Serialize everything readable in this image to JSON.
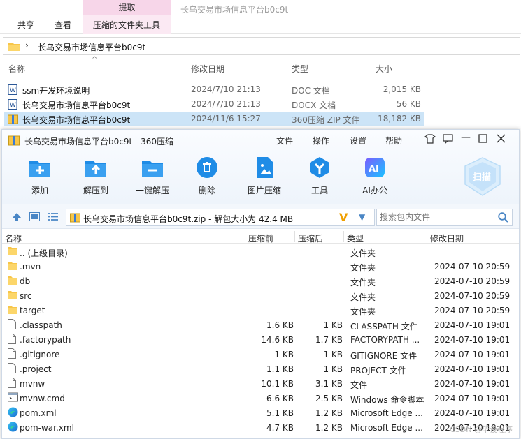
{
  "explorer": {
    "context_tab": "提取",
    "window_title": "长乌交易市场信息平台b0c9t",
    "ribbon_tabs": [
      "共享",
      "查看",
      "压缩的文件夹工具"
    ],
    "address_path": "长乌交易市场信息平台b0c9t",
    "columns": {
      "name": "名称",
      "date": "修改日期",
      "type": "类型",
      "size": "大小"
    },
    "files": [
      {
        "name": "ssm开发环境说明",
        "date": "2024/7/10 21:13",
        "type": "DOC 文档",
        "size": "2,015 KB",
        "icon": "word-doc-icon"
      },
      {
        "name": "长乌交易市场信息平台b0c9t",
        "date": "2024/7/10 21:13",
        "type": "DOCX 文档",
        "size": "56 KB",
        "icon": "word-doc-icon"
      },
      {
        "name": "长乌交易市场信息平台b0c9t",
        "date": "2024/11/6 15:27",
        "type": "360压缩 ZIP 文件",
        "size": "18,182 KB",
        "icon": "zip-archive-icon"
      }
    ]
  },
  "zip": {
    "title": "长乌交易市场信息平台b0c9t - 360压缩",
    "menu": [
      "文件",
      "操作",
      "设置",
      "帮助"
    ],
    "toolbar": [
      {
        "label": "添加",
        "icon": "add-icon"
      },
      {
        "label": "解压到",
        "icon": "extract-to-icon"
      },
      {
        "label": "一键解压",
        "icon": "one-click-extract-icon"
      },
      {
        "label": "删除",
        "icon": "delete-icon"
      },
      {
        "label": "图片压缩",
        "icon": "image-compress-icon"
      },
      {
        "label": "工具",
        "icon": "tools-icon"
      },
      {
        "label": "AI办公",
        "icon": "ai-office-icon"
      }
    ],
    "scan_label": "扫描",
    "path_text": "长乌交易市场信息平台b0c9t.zip - 解包大小为 42.4 MB",
    "search_placeholder": "搜索包内文件",
    "columns": {
      "name": "名称",
      "packed": "压缩前",
      "unpacked": "压缩后",
      "type": "类型",
      "date": "修改日期"
    },
    "rows": [
      {
        "name": ".. (上级目录)",
        "packed": "",
        "unpacked": "",
        "type": "文件夹",
        "date": "",
        "icon": "folder-icon"
      },
      {
        "name": ".mvn",
        "packed": "",
        "unpacked": "",
        "type": "文件夹",
        "date": "2024-07-10 20:59",
        "icon": "folder-icon"
      },
      {
        "name": "db",
        "packed": "",
        "unpacked": "",
        "type": "文件夹",
        "date": "2024-07-10 20:59",
        "icon": "folder-icon"
      },
      {
        "name": "src",
        "packed": "",
        "unpacked": "",
        "type": "文件夹",
        "date": "2024-07-10 20:59",
        "icon": "folder-icon"
      },
      {
        "name": "target",
        "packed": "",
        "unpacked": "",
        "type": "文件夹",
        "date": "2024-07-10 20:59",
        "icon": "folder-icon"
      },
      {
        "name": ".classpath",
        "packed": "1.6 KB",
        "unpacked": "1 KB",
        "type": "CLASSPATH 文件",
        "date": "2024-07-10 19:01",
        "icon": "file-icon"
      },
      {
        "name": ".factorypath",
        "packed": "14.6 KB",
        "unpacked": "1.7 KB",
        "type": "FACTORYPATH ...",
        "date": "2024-07-10 19:01",
        "icon": "file-icon"
      },
      {
        "name": ".gitignore",
        "packed": "1 KB",
        "unpacked": "1 KB",
        "type": "GITIGNORE 文件",
        "date": "2024-07-10 19:01",
        "icon": "file-icon"
      },
      {
        "name": ".project",
        "packed": "1.1 KB",
        "unpacked": "1 KB",
        "type": "PROJECT 文件",
        "date": "2024-07-10 19:01",
        "icon": "file-icon"
      },
      {
        "name": "mvnw",
        "packed": "10.1 KB",
        "unpacked": "3.1 KB",
        "type": "文件",
        "date": "2024-07-10 19:01",
        "icon": "file-icon"
      },
      {
        "name": "mvnw.cmd",
        "packed": "6.6 KB",
        "unpacked": "2.5 KB",
        "type": "Windows 命令脚本",
        "date": "2024-07-10 19:01",
        "icon": "cmd-script-icon"
      },
      {
        "name": "pom.xml",
        "packed": "5.1 KB",
        "unpacked": "1.2 KB",
        "type": "Microsoft Edge ...",
        "date": "2024-07-10 19:01",
        "icon": "edge-icon"
      },
      {
        "name": "pom-war.xml",
        "packed": "4.7 KB",
        "unpacked": "1.2 KB",
        "type": "Microsoft Edge ...",
        "date": "2024-07-10 19:01",
        "icon": "edge-icon"
      }
    ]
  },
  "watermark": "CSDN @毕设程序",
  "colors": {
    "accent": "#1f8ce6",
    "folder": "#f7c64a",
    "selection": "#cce4f7",
    "context_tab": "#f7d6e9"
  }
}
